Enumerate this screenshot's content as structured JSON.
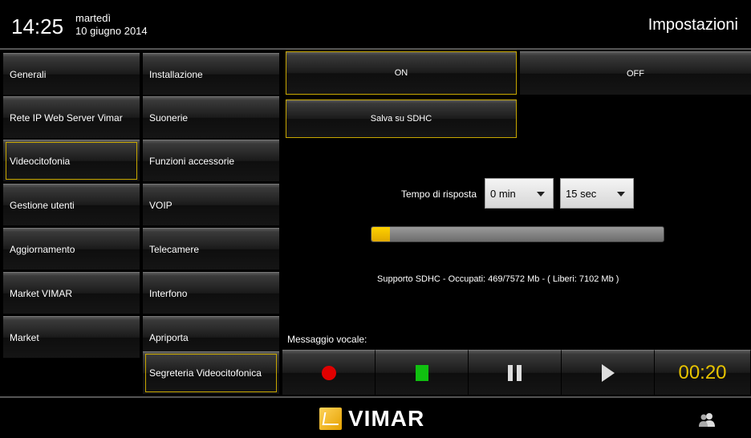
{
  "header": {
    "time": "14:25",
    "weekday": "martedì",
    "date": "10 giugno 2014",
    "title": "Impostazioni"
  },
  "menu_main": [
    {
      "label": "Generali"
    },
    {
      "label": "Rete IP Web Server Vimar"
    },
    {
      "label": "Videocitofonia",
      "selected": true
    },
    {
      "label": "Gestione utenti"
    },
    {
      "label": "Aggiornamento"
    },
    {
      "label": "Market VIMAR"
    },
    {
      "label": "Market"
    }
  ],
  "menu_sub": [
    {
      "label": "Installazione"
    },
    {
      "label": "Suonerie"
    },
    {
      "label": "Funzioni accessorie"
    },
    {
      "label": "VOIP"
    },
    {
      "label": "Telecamere"
    },
    {
      "label": "Interfono"
    },
    {
      "label": "Apriporta"
    },
    {
      "label": "Segreteria Videocitofonica",
      "selected": true
    }
  ],
  "panel": {
    "on_label": "ON",
    "off_label": "OFF",
    "save_label": "Salva su SDHC",
    "response_label": "Tempo di risposta",
    "min_value": "0 min",
    "sec_value": "15 sec",
    "storage_used_fraction": 0.062,
    "storage_text": "Supporto SDHC - Occupati: 469/7572 Mb - ( Liberi: 7102 Mb )",
    "message_label": "Messaggio vocale:",
    "timer": "00:20"
  },
  "footer": {
    "logo_text": "VIMAR"
  },
  "colors": {
    "accent": "#c8a700",
    "record": "#e00000",
    "stop": "#10c010",
    "timer": "#e6c200"
  }
}
